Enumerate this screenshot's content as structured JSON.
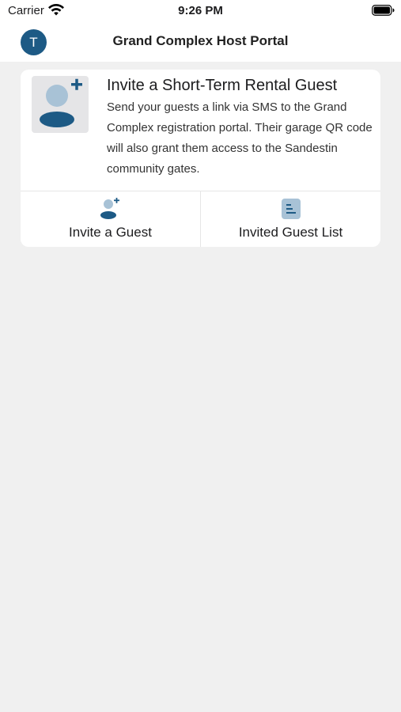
{
  "status_bar": {
    "carrier": "Carrier",
    "time": "9:26 PM"
  },
  "nav": {
    "avatar_initial": "T",
    "title": "Grand Complex Host Portal"
  },
  "invite_card": {
    "title": "Invite a Short-Term Rental Guest",
    "description": "Send your guests a link via SMS to the Grand Complex registration portal. Their garage QR code will also grant them access to the Sandestin community gates.",
    "hero_icon": "add-user-icon"
  },
  "actions": [
    {
      "label": "Invite a Guest",
      "icon": "add-user-icon"
    },
    {
      "label": "Invited Guest List",
      "icon": "list-document-icon"
    }
  ],
  "colors": {
    "brand": "#1d5a85",
    "icon_light": "#a8c2d6",
    "background": "#f0f0f0",
    "card": "#ffffff"
  }
}
